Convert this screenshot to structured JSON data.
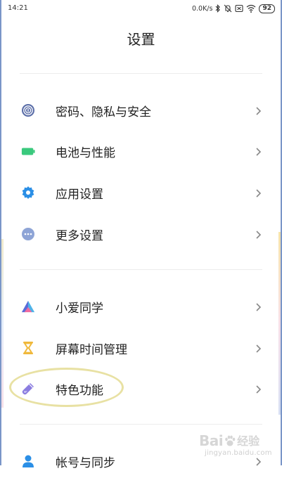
{
  "status_bar": {
    "time": "14:21",
    "net_speed": "0.0K/s",
    "battery": "92",
    "icons": [
      "bluetooth-icon",
      "mute-icon",
      "sim-disabled-icon",
      "wifi-icon",
      "battery-icon"
    ]
  },
  "header": {
    "title": "设置"
  },
  "groups": [
    {
      "items": [
        {
          "label": "密码、隐私与安全",
          "icon": "fingerprint-icon",
          "color": "#5b6ea8"
        },
        {
          "label": "电池与性能",
          "icon": "battery-icon",
          "color": "#3ac97d"
        },
        {
          "label": "应用设置",
          "icon": "gear-icon",
          "color": "#2b8fe6"
        },
        {
          "label": "更多设置",
          "icon": "more-dots-icon",
          "color": "#8ea4d6"
        }
      ]
    },
    {
      "items": [
        {
          "label": "小爱同学",
          "icon": "xiaoai-icon",
          "color": "#5a6bd8"
        },
        {
          "label": "屏幕时间管理",
          "icon": "hourglass-icon",
          "color": "#f0b93c"
        },
        {
          "label": "特色功能",
          "icon": "test-tube-icon",
          "color": "#8b7de0"
        }
      ]
    },
    {
      "items": [
        {
          "label": "帐号与同步",
          "icon": "account-icon",
          "color": "#2b8fe6"
        }
      ]
    }
  ],
  "annotation": {
    "highlight_color": "#e8e1a3"
  },
  "watermark": {
    "brand": "Bai",
    "brand_suffix": "经验",
    "url": "jingyan.baidu.com"
  }
}
